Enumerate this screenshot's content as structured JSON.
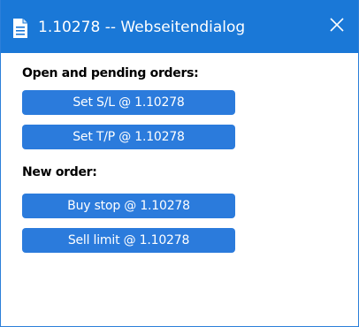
{
  "window": {
    "title": "1.10278 -- Webseitendialog",
    "close_symbol": "✕"
  },
  "sections": {
    "open_pending": {
      "heading": "Open and pending orders:",
      "set_sl_label": "Set S/L @ 1.10278",
      "set_tp_label": "Set T/P @ 1.10278"
    },
    "new_order": {
      "heading": "New order:",
      "buy_stop_label": "Buy stop @ 1.10278",
      "sell_limit_label": "Sell limit @ 1.10278"
    }
  },
  "icons": {
    "title_icon": "document-icon",
    "close_icon": "close-icon"
  },
  "colors": {
    "titlebar": "#1a78d7",
    "button": "#2b7bdc",
    "button_text": "#ffffff",
    "heading_text": "#000000"
  }
}
